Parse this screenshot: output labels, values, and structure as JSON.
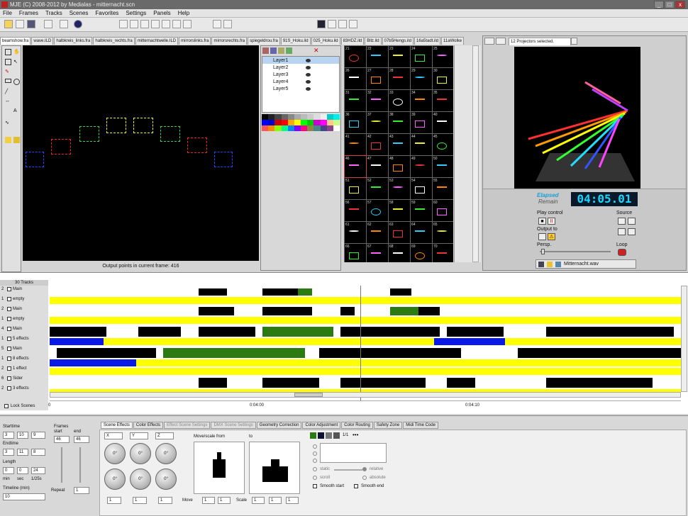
{
  "window": {
    "title": "MJE (C) 2008-2012 by Medialas - mitternacht.scn"
  },
  "menu": [
    "File",
    "Frames",
    "Tracks",
    "Scenes",
    "Favorites",
    "Settings",
    "Panels",
    "Help"
  ],
  "frame_tabs": [
    "beamshow.fra",
    "wave.ILD",
    "halbkreis_links.fra",
    "halbkreis_rechts.fra",
    "mitternachtwelle.ILD",
    "mirrorslinks.fra",
    "mirrorsrechts.fra",
    "spiegeldrou.fra",
    "91S_Hoku.ild",
    "025_Hoku.ild",
    "83HDZ.ild",
    "Bllz.ild",
    "07b5Hengs.ild",
    "16a5tadt.ild",
    "11aWolke"
  ],
  "frame_tab_numbers": [
    "21",
    "22",
    "23",
    "24"
  ],
  "editor": {
    "status": "Output points in current frame: 416"
  },
  "layers": [
    "Layer1",
    "Layer2",
    "Layer3",
    "Layer4",
    "Layer5"
  ],
  "grid_numbers": [
    "21",
    "22",
    "23",
    "24",
    "25",
    "26",
    "27",
    "28",
    "29",
    "30",
    "31",
    "32",
    "33",
    "34",
    "35",
    "36",
    "37",
    "38",
    "39",
    "40",
    "41",
    "42",
    "43",
    "44",
    "45",
    "46",
    "47",
    "48",
    "49",
    "50",
    "51",
    "52",
    "53",
    "54",
    "55",
    "56",
    "57",
    "58",
    "59",
    "60",
    "61",
    "62",
    "63",
    "64",
    "65",
    "66",
    "67",
    "68",
    "69",
    "70"
  ],
  "projector": {
    "tab": "12 Projectors selected.",
    "elapsed_label": "Elapsed",
    "remain_label": "Remain",
    "time": "04:05.01",
    "play_control": "Play control",
    "output_to": "Output to",
    "source": "Source",
    "persp": "Persp.",
    "loop": "Loop",
    "file": "Mitternacht.wav"
  },
  "timeline": {
    "tracks_header": "30 Tracks",
    "lock_scenes": "Lock Scenes",
    "ticks": [
      "0",
      "0:04:00",
      "0:04:10"
    ],
    "tracks": [
      {
        "num": "2",
        "name": "Main"
      },
      {
        "num": "1",
        "name": "empty"
      },
      {
        "num": "2",
        "name": "Main"
      },
      {
        "num": "1",
        "name": "empty"
      },
      {
        "num": "4",
        "name": "Main"
      },
      {
        "num": "1",
        "name": "5 effects"
      },
      {
        "num": "5",
        "name": "Main"
      },
      {
        "num": "1",
        "name": "8 effects"
      },
      {
        "num": "2",
        "name": "1 effect"
      },
      {
        "num": "6",
        "name": "Sider"
      },
      {
        "num": "2",
        "name": "3 effects"
      }
    ]
  },
  "bottom_tabs": [
    "Scene Effects",
    "Color Effects",
    "Effect Scene Settings",
    "DMX Scene Settings",
    "Geometry Correction",
    "Color Adjustment",
    "Color Routing",
    "Safety Zone",
    "Midi Time Code"
  ],
  "timing": {
    "starttime": "Starttime",
    "endtime": "Endtime",
    "length": "Length",
    "frames": "Frames",
    "start": "start",
    "end": "end",
    "frames_start": "46",
    "frames_end": "46",
    "min": "min",
    "sec": "sec",
    "fps": "1/25s",
    "timeline_min": "Timeline (min)",
    "timeline_val": "10",
    "repeat": "Repeat",
    "repeat_val": "1",
    "start_vals": [
      "3",
      "10",
      "9"
    ],
    "end_vals": [
      "3",
      "11",
      "8"
    ],
    "length_vals": [
      "0",
      "0",
      "24"
    ]
  },
  "effects": {
    "axes": [
      "X",
      "Y",
      "Z"
    ],
    "dial_value": "0°",
    "spin_val": "1",
    "move_from": "Move/scale from",
    "to": "to",
    "move": "Move",
    "scale": "Scale",
    "static": "static",
    "relative": "relative",
    "scroll": "scroll",
    "absolute": "absolute",
    "smooth_start": "Smooth start",
    "smooth_end": "Smooth end",
    "counter": "1/1"
  },
  "colors": {
    "yellow": "#ffff00",
    "blue": "#0a1ae6",
    "green": "#2c7a12",
    "accent": "#1ad7ff"
  }
}
